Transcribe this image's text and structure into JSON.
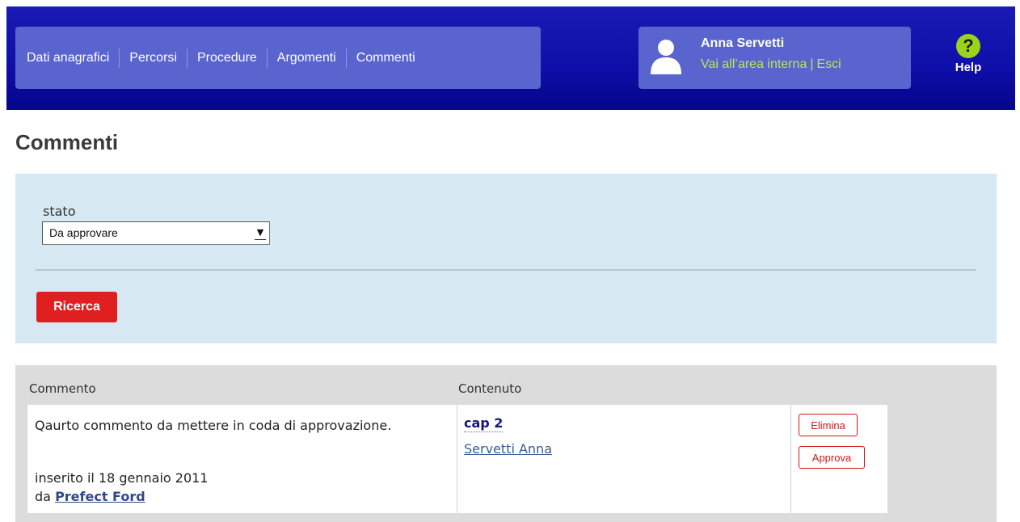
{
  "nav": {
    "items": [
      {
        "label": "Dati anagrafici"
      },
      {
        "label": "Percorsi"
      },
      {
        "label": "Procedure"
      },
      {
        "label": "Argomenti"
      },
      {
        "label": "Commenti"
      }
    ]
  },
  "user": {
    "name": "Anna Servetti",
    "internal_area_link": "Vai all’area interna",
    "separator": "|",
    "logout_link": "Esci"
  },
  "help": {
    "icon_glyph": "?",
    "label": "Help"
  },
  "page": {
    "title": "Commenti"
  },
  "filter": {
    "status_label": "stato",
    "status_selected": "Da approvare",
    "search_button": "Ricerca"
  },
  "results": {
    "columns": [
      "Commento",
      "Contenuto"
    ],
    "rows": [
      {
        "comment": "Qaurto commento da mettere in coda di approvazione.",
        "inserted": "inserito il 18 gennaio 2011",
        "by_prefix": "da",
        "author": "Prefect Ford",
        "content_title": "cap 2",
        "content_author": "Servetti Anna",
        "delete_label": "Elimina",
        "approve_label": "Approva"
      }
    ]
  },
  "colors": {
    "header_blue": "#0e0ea8",
    "nav_panel": "#5a64cf",
    "link_green": "#b9e84a",
    "filter_bg": "#d6e9f2",
    "search_red": "#e02020",
    "results_bg": "#dcdcdc"
  }
}
